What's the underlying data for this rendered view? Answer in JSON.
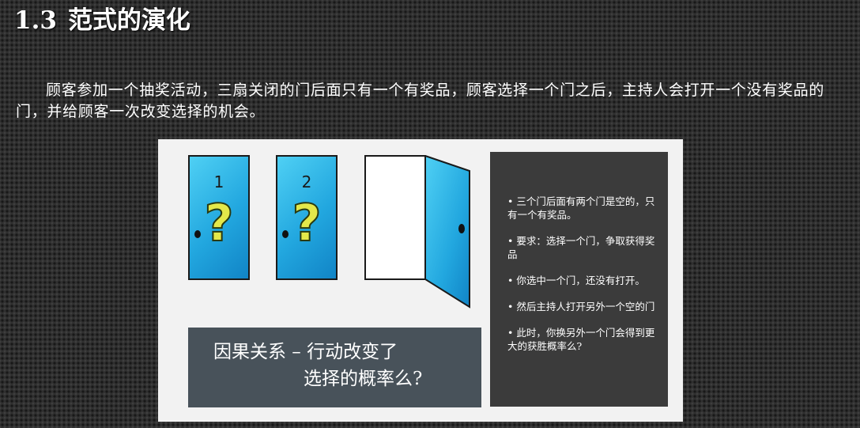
{
  "slide": {
    "number": "1.3",
    "title": "范式的演化",
    "intro": "顾客参加一个抽奖活动，三扇关闭的门后面只有一个有奖品，顾客选择一个门之后，主持人会打开一个没有奖品的门，并给顾客一次改变选择的机会。"
  },
  "figure": {
    "doors": [
      {
        "label": "1",
        "mark": "?"
      },
      {
        "label": "2",
        "mark": "?"
      }
    ],
    "caption": {
      "line1": "因果关系  – 行动改变了",
      "line2": "选择的概率么?"
    },
    "notes": [
      "• 三个门后面有两个门是空的，只有一个有奖品。",
      "• 要求：选择一个门，争取获得奖品",
      "• 你选中一个门，还没有打开。",
      "• 然后主持人打开另外一个空的门",
      "• 此时，你换另外一个门会得到更大的获胜概率么?"
    ],
    "colors": {
      "door_blue": "#22a7df",
      "question_yellow": "#e3e84a",
      "caption_bg": "#48525a",
      "notes_bg": "#3b3b3b"
    }
  }
}
